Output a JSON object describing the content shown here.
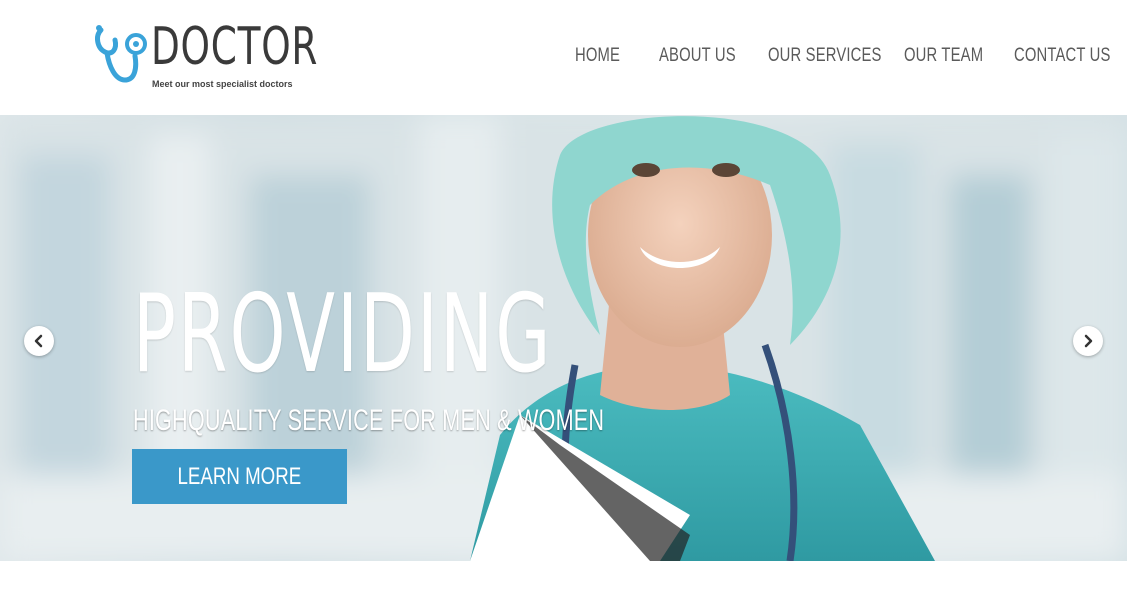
{
  "logo": {
    "name": "DOCTOR",
    "tagline": "Meet our most specialist doctors",
    "icon": "stethoscope-icon",
    "icon_color": "#3aa3d9"
  },
  "nav": {
    "items": [
      {
        "label": "HOME"
      },
      {
        "label": "ABOUT US"
      },
      {
        "label": "OUR SERVICES"
      },
      {
        "label": "OUR TEAM"
      },
      {
        "label": "CONTACT US"
      }
    ]
  },
  "hero": {
    "title": "PROVIDING",
    "subtitle": "HIGHQUALITY SERVICE FOR MEN & WOMEN",
    "button_label": "LEARN MORE",
    "button_color": "#3a98c9",
    "prev_icon": "chevron-left-icon",
    "next_icon": "chevron-right-icon"
  }
}
